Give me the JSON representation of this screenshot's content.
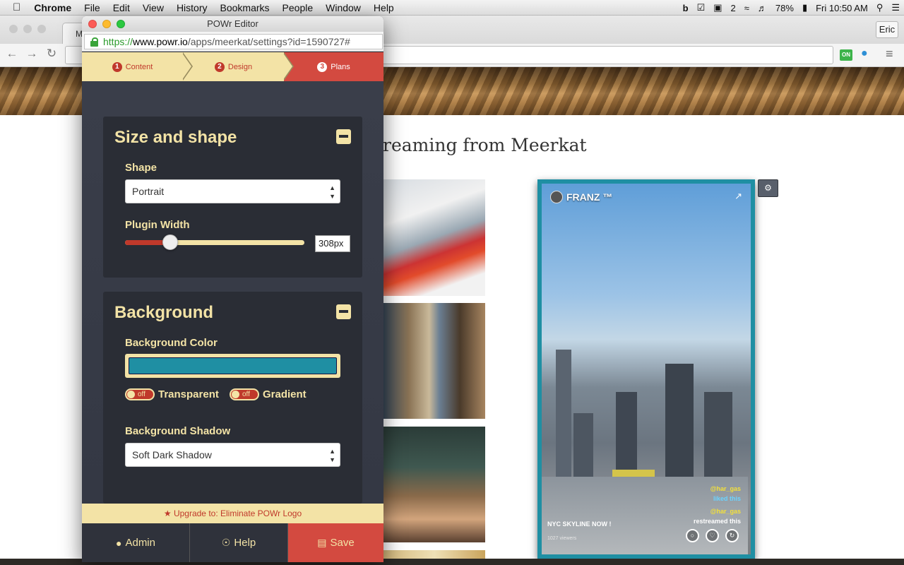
{
  "menubar": {
    "app": "Chrome",
    "items": [
      "File",
      "Edit",
      "View",
      "History",
      "Bookmarks",
      "People",
      "Window",
      "Help"
    ],
    "status_right": {
      "extra_count": "2",
      "battery": "78%",
      "clock": "Fri 10:50 AM"
    }
  },
  "browser": {
    "tab_label": "M",
    "user_button": "Eric",
    "extension_on_label": "ON"
  },
  "page": {
    "title": "reaming from Meerkat",
    "meerkat": {
      "username": "FRANZ ™",
      "comments": [
        "@har_gas",
        "liked this",
        "@har_gas",
        "restreamed this"
      ],
      "stream_title": "NYC SKYLINE NOW !",
      "viewers": "1027 viewers",
      "border_color": "#1f8fa3"
    }
  },
  "editor": {
    "window_title": "POWr Editor",
    "url": {
      "scheme": "https://",
      "host": "www.powr.io",
      "path": "/apps/meerkat/settings?id=1590727#"
    },
    "steps": [
      {
        "num": "1",
        "label": "Content"
      },
      {
        "num": "2",
        "label": "Design"
      },
      {
        "num": "3",
        "label": "Plans"
      }
    ],
    "size_shape": {
      "title": "Size and shape",
      "shape_label": "Shape",
      "shape_value": "Portrait",
      "width_label": "Plugin Width",
      "width_value": "308px",
      "width_slider_fraction": 0.25
    },
    "background": {
      "title": "Background",
      "color_label": "Background Color",
      "color_value": "#1f8fa3",
      "transparent_label": "Transparent",
      "transparent_state": "off",
      "gradient_label": "Gradient",
      "gradient_state": "off",
      "shadow_label": "Background Shadow",
      "shadow_value": "Soft Dark Shadow"
    },
    "upgrade_text": "Upgrade to: Eliminate POWr Logo",
    "footer": {
      "admin": "Admin",
      "help": "Help",
      "save": "Save"
    }
  }
}
